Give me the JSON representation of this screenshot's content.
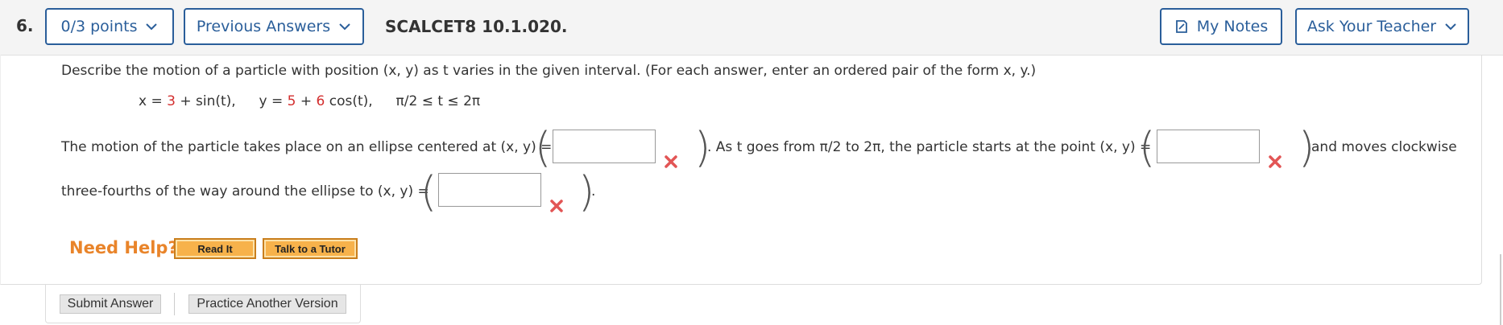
{
  "header": {
    "number": "6.",
    "points_label": "0/3 points",
    "previous_answers_label": "Previous Answers",
    "code": "SCALCET8 10.1.020.",
    "my_notes_label": "My Notes",
    "ask_teacher_label": "Ask Your Teacher"
  },
  "question": {
    "intro": "Describe the motion of a particle with position (x, y) as t varies in the given interval. (For each answer, enter an ordered pair of the form x, y.)",
    "equation": {
      "x_prefix": "x = ",
      "x_const": "3",
      "x_suffix": " + sin(t),",
      "y_prefix": "y = ",
      "y_const": "5",
      "y_mid": " + ",
      "y_coef": "6",
      "y_suffix": " cos(t),",
      "interval": "π/2 ≤ t ≤ 2π"
    },
    "sentence_1": "The motion of the particle takes place on an ellipse centered at (x, y) =",
    "sentence_2": ". As t goes from π/2 to 2π, the particle starts at the point (x, y) =",
    "sentence_3": "and moves clockwise",
    "sentence_4": "three-fourths of the way around the ellipse to (x, y) =",
    "sentence_end": ".",
    "answers": [
      "",
      "",
      ""
    ],
    "status": [
      "incorrect",
      "incorrect",
      "incorrect"
    ]
  },
  "help": {
    "need_help": "Need Help?",
    "read_it": "Read It",
    "talk_tutor": "Talk to a Tutor"
  },
  "footer": {
    "submit": "Submit Answer",
    "practice": "Practice Another Version"
  },
  "colors": {
    "accent": "#2a5e9a",
    "error": "#d32f2f",
    "help_orange": "#e9842a"
  }
}
